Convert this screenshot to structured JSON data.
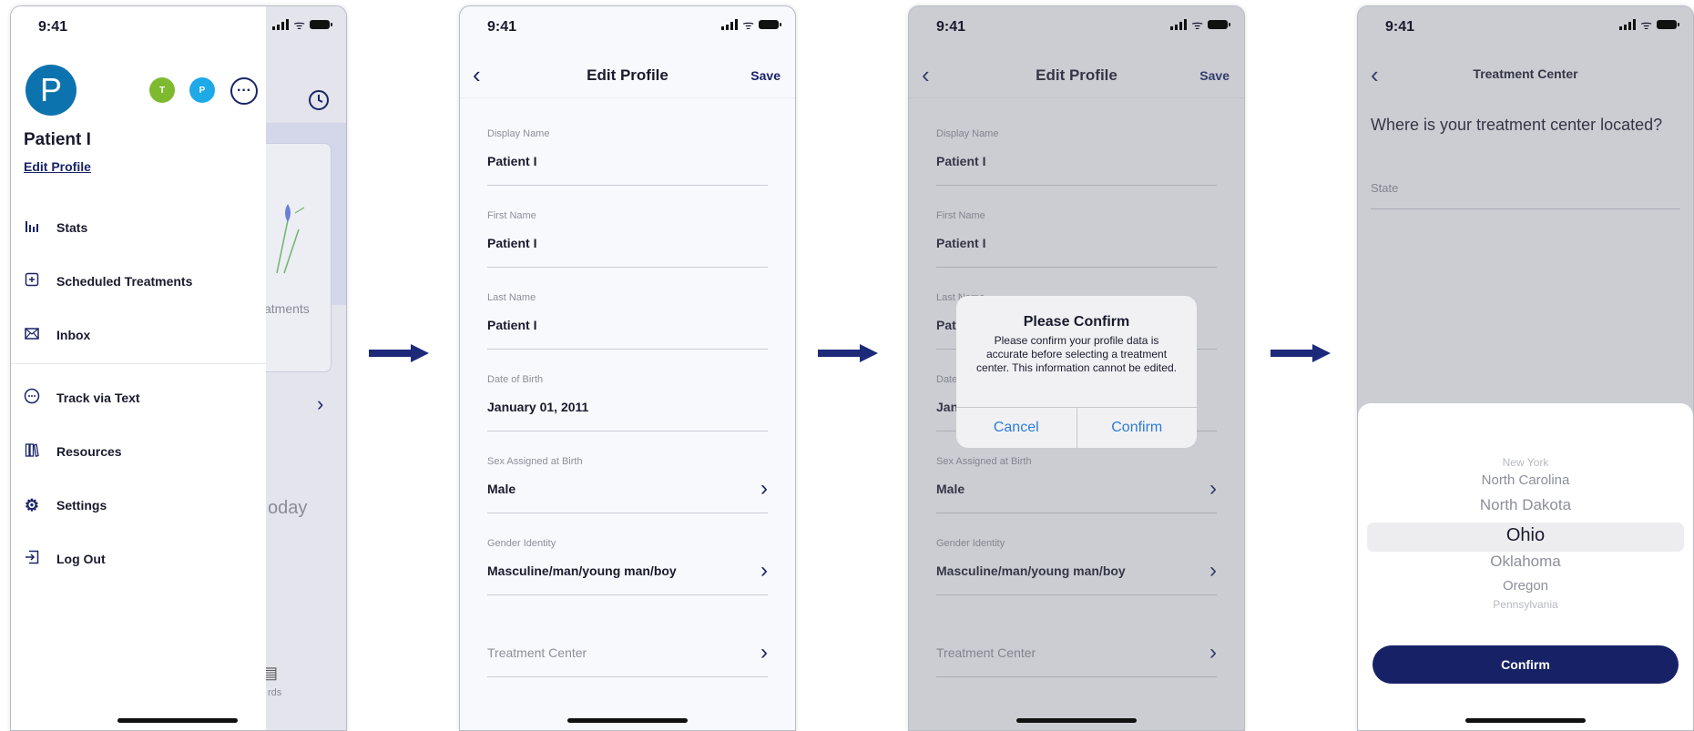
{
  "status_bar": {
    "time": "9:41"
  },
  "screen1": {
    "avatar_letter": "P",
    "badges": [
      {
        "letter": "T",
        "color": "#7dba2f"
      },
      {
        "letter": "P",
        "color": "#1ea9e9"
      }
    ],
    "more_icon": "more-horizontal-icon",
    "patient_name": "Patient I",
    "edit_profile_link": "Edit Profile",
    "menu": [
      {
        "label": "Stats",
        "icon": "bar-chart-icon"
      },
      {
        "label": "Scheduled Treatments",
        "icon": "calendar-plus-icon"
      },
      {
        "label": "Inbox",
        "icon": "envelope-icon"
      },
      {
        "label": "Track via Text",
        "icon": "chat-bubble-icon"
      },
      {
        "label": "Resources",
        "icon": "books-icon"
      },
      {
        "label": "Settings",
        "icon": "gear-icon"
      },
      {
        "label": "Log Out",
        "icon": "logout-icon"
      }
    ],
    "background_fragments": {
      "treatments": "atments",
      "today": "oday",
      "records": "rds"
    }
  },
  "edit_profile": {
    "title": "Edit Profile",
    "save_label": "Save",
    "fields": [
      {
        "label": "Display Name",
        "value": "Patient I"
      },
      {
        "label": "First Name",
        "value": "Patient I"
      },
      {
        "label": "Last Name",
        "value": "Patient I"
      },
      {
        "label": "Date of Birth",
        "value": "January 01, 2011"
      },
      {
        "label": "Sex Assigned at Birth",
        "value": "Male"
      },
      {
        "label": "Gender Identity",
        "value": "Masculine/man/young man/boy"
      }
    ],
    "treatment_center_placeholder": "Treatment Center"
  },
  "screen3": {
    "alert": {
      "title": "Please Confirm",
      "message": "Please confirm your profile data is accurate before selecting a treatment center. This information cannot be edited.",
      "cancel_label": "Cancel",
      "confirm_label": "Confirm"
    }
  },
  "screen4": {
    "title": "Treatment Center",
    "question": "Where is your treatment center located?",
    "state_placeholder": "State",
    "picker": {
      "options": [
        "New York",
        "North Carolina",
        "North Dakota",
        "Ohio",
        "Oklahoma",
        "Oregon",
        "Pennsylvania"
      ],
      "selected": "Ohio"
    },
    "confirm_label": "Confirm"
  },
  "colors": {
    "navy": "#172266",
    "link_blue": "#2d7bd6",
    "avatar_blue": "#0d73ae"
  }
}
